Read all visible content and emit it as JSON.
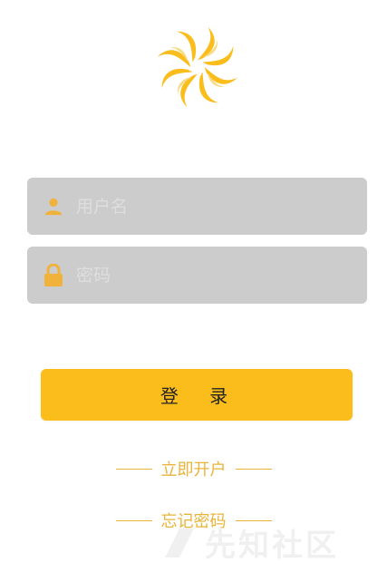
{
  "logo": {
    "icon": "sun-swirl-logo",
    "color_primary": "#fbbd1b",
    "color_secondary": "#f2c23a"
  },
  "username": {
    "placeholder": "用户名",
    "value": "",
    "icon": "user-icon",
    "icon_color": "#f0b23a"
  },
  "password": {
    "placeholder": "密码",
    "value": "",
    "icon": "lock-icon",
    "icon_color": "#f0b23a"
  },
  "login_button": {
    "label": "登 录",
    "color": "#fbbd1b"
  },
  "links": {
    "register": "立即开户",
    "forgot": "忘记密码",
    "color": "#e9b43a"
  },
  "watermark": {
    "text": "先知社区"
  }
}
